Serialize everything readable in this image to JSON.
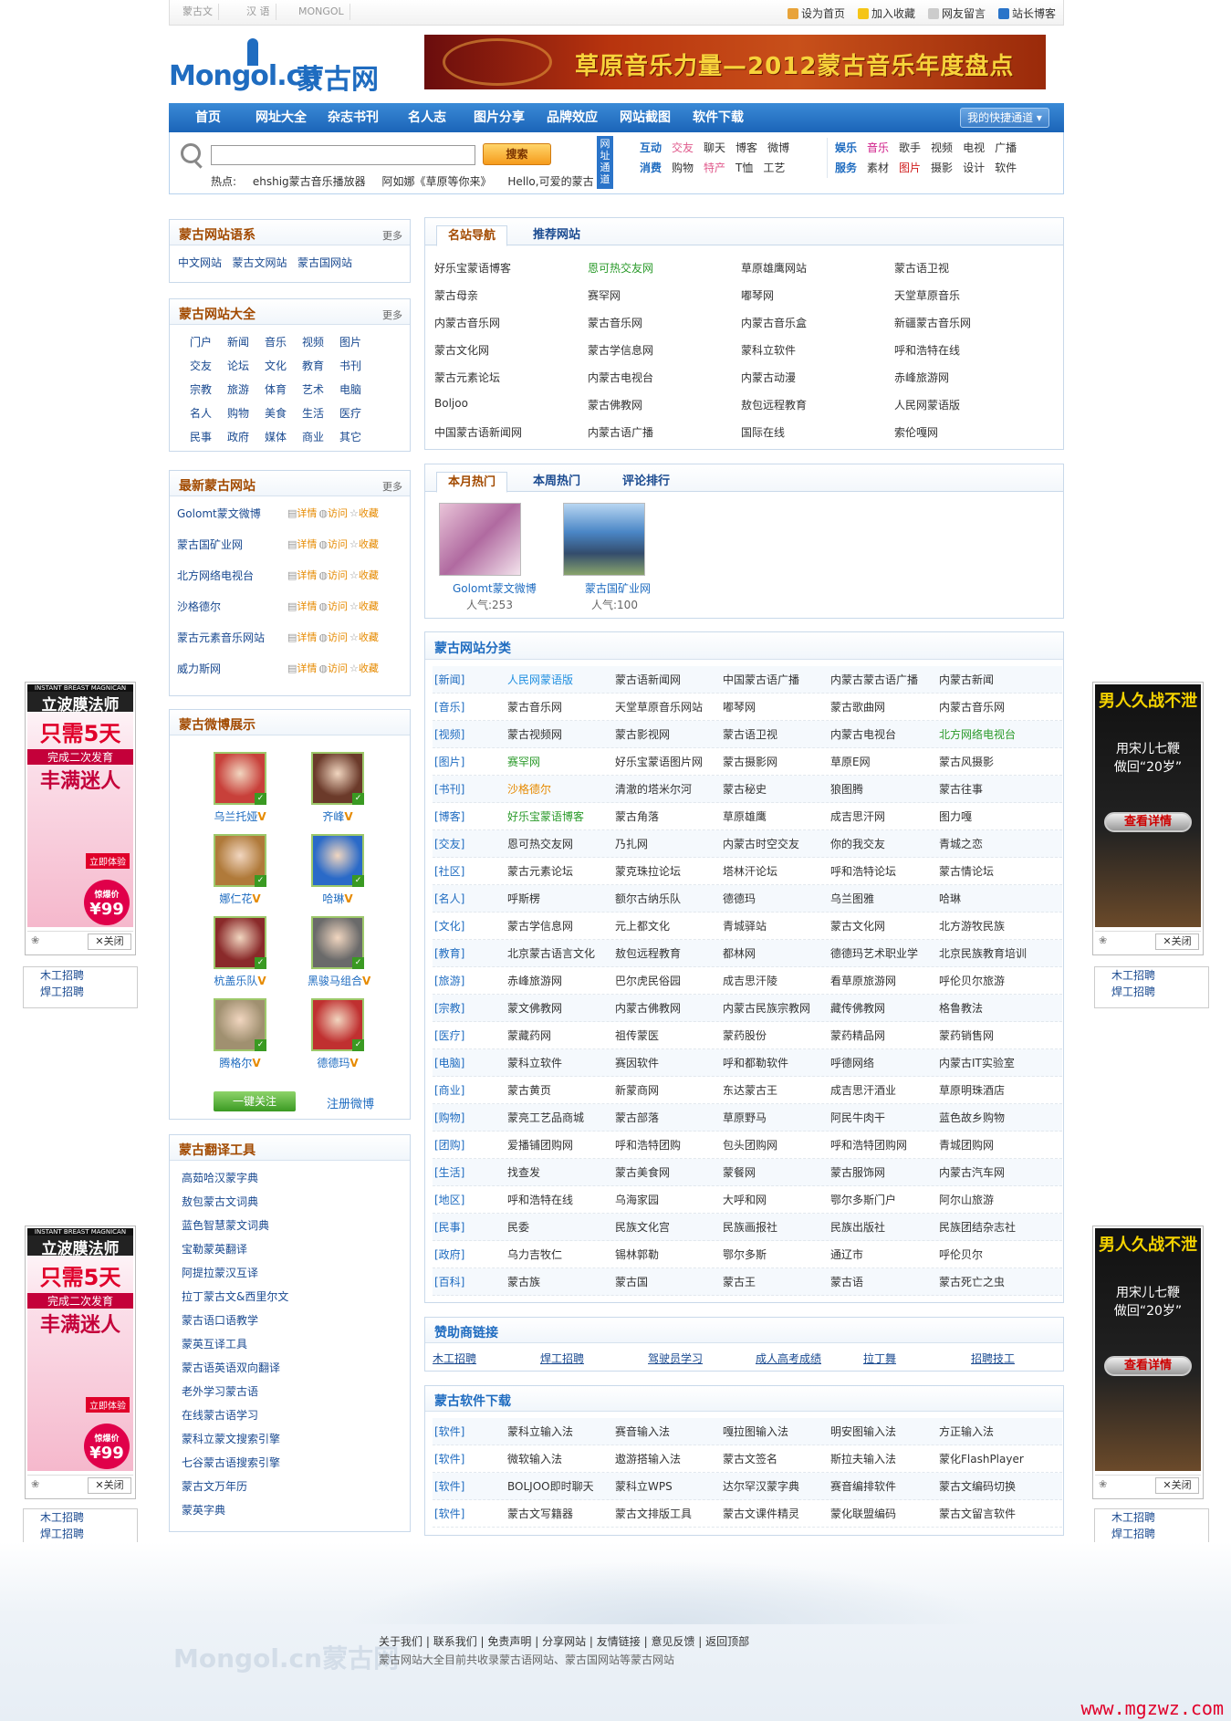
{
  "topbar": {
    "langs": [
      "蒙古文",
      "汉 语",
      "MONGOL"
    ],
    "links": [
      "设为首页",
      "加入收藏",
      "网友留言",
      "站长博客"
    ]
  },
  "header": {
    "logo_text": "Mongol.cn",
    "logo_cn": "蒙古网",
    "banner_text": "草原音乐力量—2012蒙古音乐年度盘点"
  },
  "nav": {
    "items": [
      "首页",
      "网址大全",
      "杂志书刊",
      "名人志",
      "图片分享",
      "品牌效应",
      "网站截图",
      "软件下载"
    ],
    "quick": "我的快捷通道"
  },
  "search": {
    "button": "搜索",
    "hot_label": "热点:",
    "hot": [
      "ehshig蒙古音乐播放器",
      "阿如娜《草原等你来》",
      "Hello,可爱的蒙古"
    ],
    "vtab": "网址通道",
    "row1_label": "互动",
    "row1": [
      "交友",
      "聊天",
      "博客",
      "微博"
    ],
    "row2_label": "消费",
    "row2": [
      "购物",
      "特产",
      "T恤",
      "工艺"
    ],
    "row3_label": "娱乐",
    "row3": [
      "音乐",
      "歌手",
      "视频",
      "电视",
      "广播"
    ],
    "row4_label": "服务",
    "row4": [
      "素材",
      "图片",
      "摄影",
      "设计",
      "软件"
    ]
  },
  "left": {
    "lang_sys": {
      "title": "蒙古网站语系",
      "more": "更多",
      "items": [
        "中文网站",
        "蒙古文网站",
        "蒙古国网站"
      ]
    },
    "site_all": {
      "title": "蒙古网站大全",
      "more": "更多",
      "items": [
        "门户",
        "新闻",
        "音乐",
        "视频",
        "图片",
        "交友",
        "论坛",
        "文化",
        "教育",
        "书刊",
        "宗教",
        "旅游",
        "体育",
        "艺术",
        "电脑",
        "名人",
        "购物",
        "美食",
        "生活",
        "医疗",
        "民事",
        "政府",
        "媒体",
        "商业",
        "其它"
      ]
    },
    "newest": {
      "title": "最新蒙古网站",
      "more": "更多",
      "ops": [
        "详情",
        "访问",
        "收藏"
      ],
      "items": [
        "Golomt蒙文微博",
        "蒙古国矿业网",
        "北方网络电视台",
        "沙格德尔",
        "蒙古元素音乐网站",
        "威力斯网"
      ]
    },
    "weibo": {
      "title": "蒙古微博展示",
      "people": [
        "乌兰托娅",
        "齐峰",
        "娜仁花",
        "哈琳",
        "杭盖乐队",
        "黑骏马组合",
        "腾格尔",
        "德德玛"
      ],
      "follow_btn": "一键关注",
      "register": "注册微博"
    },
    "trans": {
      "title": "蒙古翻译工具",
      "items": [
        "高茹哈汉蒙字典",
        "敖包蒙古文词典",
        "蓝色智慧蒙文词典",
        "宝勒蒙英翻译",
        "阿提拉蒙汉互译",
        "拉丁蒙古文&西里尔文",
        "蒙古语口语教学",
        "蒙英互译工具",
        "蒙古语英语双向翻译",
        "老外学习蒙古语",
        "在线蒙古语学习",
        "蒙科立蒙文搜索引擎",
        "七谷蒙古语搜索引擎",
        "蒙古文万年历",
        "蒙英字典"
      ]
    }
  },
  "famous": {
    "tabs": [
      "名站导航",
      "推荐网站"
    ],
    "items": [
      "好乐宝蒙语博客",
      "恩可热交友网",
      "草原雄鹰网站",
      "蒙古语卫视",
      "蒙古母亲",
      "赛罕网",
      "嘟琴网",
      "天堂草原音乐",
      "内蒙古音乐网",
      "蒙古音乐网",
      "内蒙古音乐盒",
      "新疆蒙古音乐网",
      "蒙古文化网",
      "蒙古学信息网",
      "蒙科立软件",
      "呼和浩特在线",
      "蒙古元素论坛",
      "内蒙古电视台",
      "内蒙古动漫",
      "赤峰旅游网",
      "Boljoo",
      "蒙古佛教网",
      "敖包远程教育",
      "人民网蒙语版",
      "中国蒙古语新闻网",
      "内蒙古语广播",
      "国际在线",
      "索伦嘎网"
    ]
  },
  "hot": {
    "tabs": [
      "本月热门",
      "本周热门",
      "评论排行"
    ],
    "pop_label": "人气:",
    "items": [
      {
        "name": "Golomt蒙文微博",
        "pop": "253"
      },
      {
        "name": "蒙古国矿业网",
        "pop": "100"
      }
    ]
  },
  "categories": {
    "title": "蒙古网站分类",
    "rows": [
      {
        "k": "[新闻]",
        "v": [
          "人民网蒙语版",
          "蒙古语新闻网",
          "中国蒙古语广播",
          "内蒙古蒙古语广播",
          "内蒙古新闻"
        ]
      },
      {
        "k": "[音乐]",
        "v": [
          "蒙古音乐网",
          "天堂草原音乐网站",
          "嘟琴网",
          "蒙古歌曲网",
          "内蒙古音乐网"
        ]
      },
      {
        "k": "[视频]",
        "v": [
          "蒙古视频网",
          "蒙古影视网",
          "蒙古语卫视",
          "内蒙古电视台",
          "北方网络电视台"
        ]
      },
      {
        "k": "[图片]",
        "v": [
          "赛罕网",
          "好乐宝蒙语图片网",
          "蒙古摄影网",
          "草原E网",
          "蒙古风摄影"
        ]
      },
      {
        "k": "[书刊]",
        "v": [
          "沙格德尔",
          "清澈的塔米尔河",
          "蒙古秘史",
          "狼图腾",
          "蒙古往事"
        ]
      },
      {
        "k": "[博客]",
        "v": [
          "好乐宝蒙语博客",
          "蒙古角落",
          "草原雄鹰",
          "成吉思汗网",
          "图力嘎"
        ]
      },
      {
        "k": "[交友]",
        "v": [
          "恩可热交友网",
          "乃扎网",
          "内蒙古时空交友",
          "你的我交友",
          "青城之恋"
        ]
      },
      {
        "k": "[社区]",
        "v": [
          "蒙古元素论坛",
          "蒙克珠拉论坛",
          "塔林汗论坛",
          "呼和浩特论坛",
          "蒙古情论坛"
        ]
      },
      {
        "k": "[名人]",
        "v": [
          "呼斯楞",
          "额尔古纳乐队",
          "德德玛",
          "乌兰图雅",
          "哈琳"
        ]
      },
      {
        "k": "[文化]",
        "v": [
          "蒙古学信息网",
          "元上都文化",
          "青城驿站",
          "蒙古文化网",
          "北方游牧民族"
        ]
      },
      {
        "k": "[教育]",
        "v": [
          "北京蒙古语言文化",
          "敖包远程教育",
          "都林网",
          "德德玛艺术职业学",
          "北京民族教育培训"
        ]
      },
      {
        "k": "[旅游]",
        "v": [
          "赤峰旅游网",
          "巴尔虎民俗园",
          "成吉思汗陵",
          "看草原旅游网",
          "呼伦贝尔旅游"
        ]
      },
      {
        "k": "[宗教]",
        "v": [
          "蒙文佛教网",
          "内蒙古佛教网",
          "内蒙古民族宗教网",
          "藏传佛教网",
          "格鲁教法"
        ]
      },
      {
        "k": "[医疗]",
        "v": [
          "蒙藏药网",
          "祖传蒙医",
          "蒙药股份",
          "蒙药精品网",
          "蒙药销售网"
        ]
      },
      {
        "k": "[电脑]",
        "v": [
          "蒙科立软件",
          "赛因软件",
          "呼和都勒软件",
          "呼德网络",
          "内蒙古IT实验室"
        ]
      },
      {
        "k": "[商业]",
        "v": [
          "蒙古黄页",
          "新蒙商网",
          "东达蒙古王",
          "成吉思汗酒业",
          "草原明珠酒店"
        ]
      },
      {
        "k": "[购物]",
        "v": [
          "蒙亮工艺品商城",
          "蒙古部落",
          "草原野马",
          "阿民牛肉干",
          "蓝色故乡购物"
        ]
      },
      {
        "k": "[团购]",
        "v": [
          "爱播铺团购网",
          "呼和浩特团购",
          "包头团购网",
          "呼和浩特团购网",
          "青城团购网"
        ]
      },
      {
        "k": "[生活]",
        "v": [
          "找查发",
          "蒙古美食网",
          "蒙餐网",
          "蒙古服饰网",
          "内蒙古汽车网"
        ]
      },
      {
        "k": "[地区]",
        "v": [
          "呼和浩特在线",
          "乌海家园",
          "大呼和网",
          "鄂尔多斯门户",
          "阿尔山旅游"
        ]
      },
      {
        "k": "[民事]",
        "v": [
          "民委",
          "民族文化宫",
          "民族画报社",
          "民族出版社",
          "民族团结杂志社"
        ]
      },
      {
        "k": "[政府]",
        "v": [
          "乌力吉牧仁",
          "锡林郭勒",
          "鄂尔多斯",
          "通辽市",
          "呼伦贝尔"
        ]
      },
      {
        "k": "[百科]",
        "v": [
          "蒙古族",
          "蒙古国",
          "蒙古王",
          "蒙古语",
          "蒙古死亡之虫"
        ]
      }
    ]
  },
  "sponsor": {
    "title": "赞助商链接",
    "items": [
      "木工招聘",
      "焊工招聘",
      "驾驶员学习",
      "成人高考成绩",
      "拉丁舞",
      "招聘技工"
    ]
  },
  "software": {
    "title": "蒙古软件下载",
    "rows": [
      {
        "k": "[软件]",
        "v": [
          "蒙科立输入法",
          "赛音输入法",
          "嘎拉图输入法",
          "明安图输入法",
          "方正输入法"
        ]
      },
      {
        "k": "[软件]",
        "v": [
          "微软输入法",
          "遨游搭输入法",
          "蒙古文签名",
          "斯拉夫输入法",
          "蒙化FlashPlayer"
        ]
      },
      {
        "k": "[软件]",
        "v": [
          "BOLJOO即时聊天",
          "蒙科立WPS",
          "达尔罕汉蒙字典",
          "赛音编排软件",
          "蒙古文编码切换"
        ]
      },
      {
        "k": "[软件]",
        "v": [
          "蒙古文写籍器",
          "蒙古文排版工具",
          "蒙古文课件精灵",
          "蒙化联盟编码",
          "蒙古文留言软件"
        ]
      }
    ]
  },
  "ads": {
    "left_top": [
      "INSTANT BREAST MAGNICAN",
      "立波膜法师",
      "只需5天",
      "完成二次发育",
      "丰满迷人",
      "立即体验",
      "惊爆价",
      "¥99"
    ],
    "right_top": [
      "男人久战不泄",
      "用宋儿七鞭",
      "做回“20岁”",
      "查看详情"
    ],
    "close": "关闭",
    "jobs": [
      "木工招聘",
      "焊工招聘"
    ]
  },
  "footer": {
    "links": [
      "关于我们",
      "联系我们",
      "免责声明",
      "分享网站",
      "友情链接",
      "意见反馈",
      "返回顶部"
    ],
    "desc": "蒙古网站大全目前共收录蒙古语网站、蒙古国网站等蒙古网站",
    "watermark": "www.mgzwz.com"
  }
}
